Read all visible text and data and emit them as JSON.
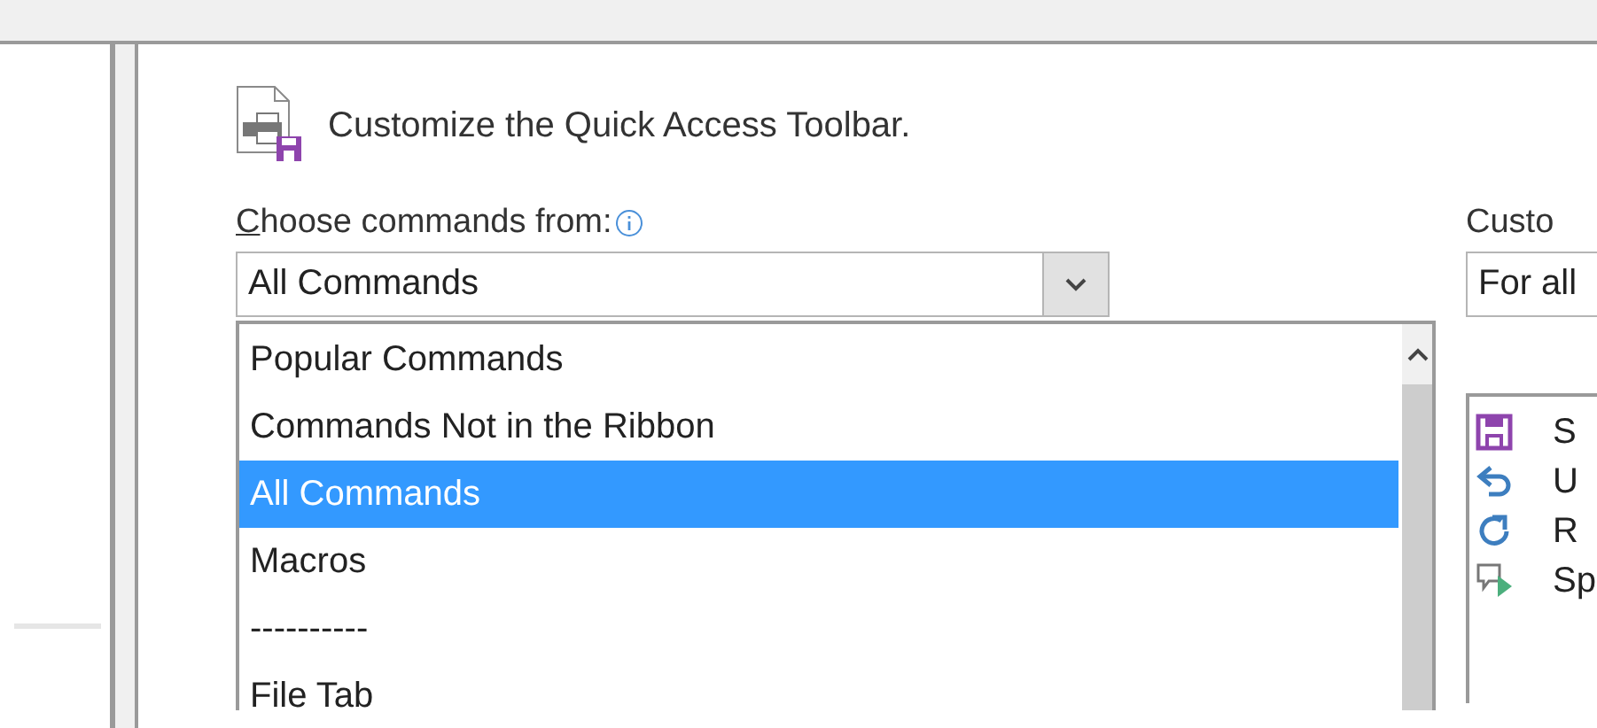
{
  "header": {
    "title": "Customize the Quick Access Toolbar."
  },
  "commands_from": {
    "label": "Choose commands from:",
    "value": "All Commands",
    "expanded": true,
    "options": [
      {
        "label": "Popular Commands",
        "selected": false
      },
      {
        "label": "Commands Not in the Ribbon",
        "selected": false
      },
      {
        "label": "All Commands",
        "selected": true
      },
      {
        "label": "Macros",
        "selected": false
      },
      {
        "label": "----------",
        "selected": false
      },
      {
        "label": "File Tab",
        "selected": false
      }
    ]
  },
  "customize_toolbar": {
    "label": "Custo",
    "value": "For all",
    "items": [
      {
        "kind": "save",
        "label": "S"
      },
      {
        "kind": "undo",
        "label": "U"
      },
      {
        "kind": "redo",
        "label": "R"
      },
      {
        "kind": "speak",
        "label": "Sp"
      }
    ]
  }
}
